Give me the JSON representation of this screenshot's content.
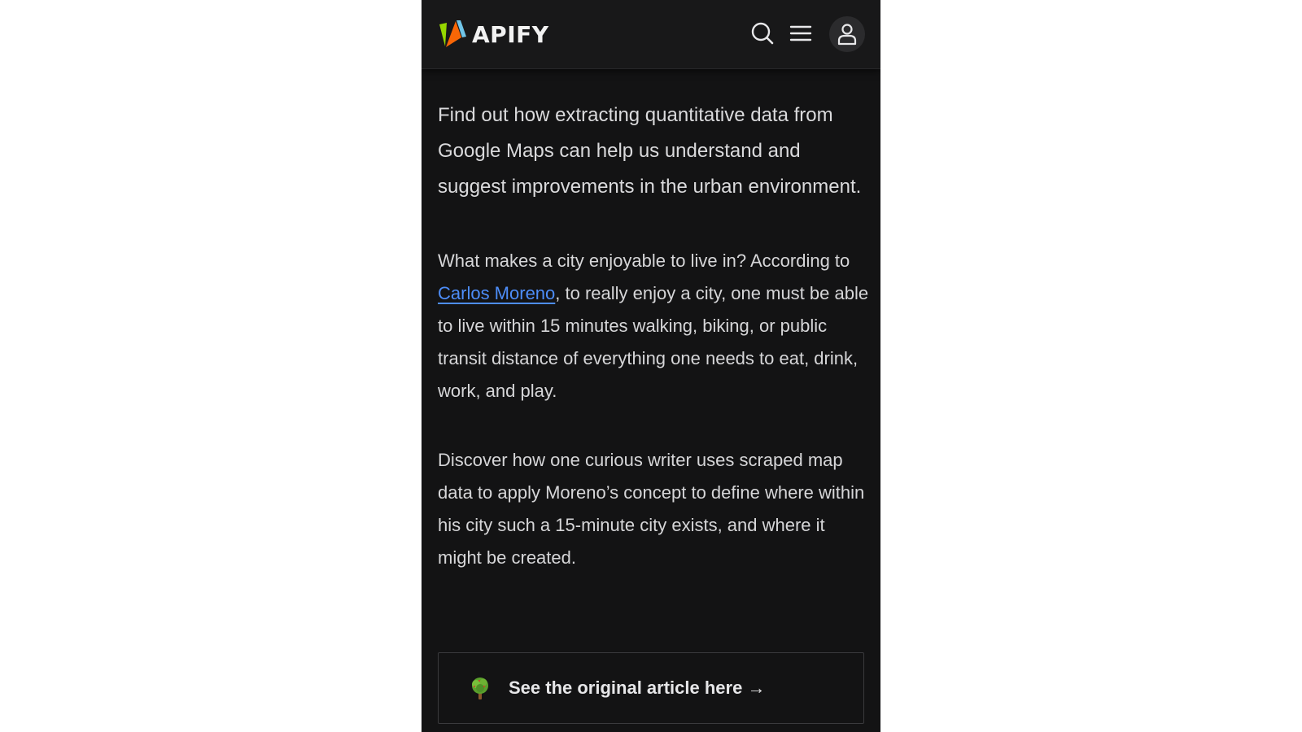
{
  "header": {
    "brand": "APIFY",
    "brand_colors": [
      "#97d700",
      "#f86606",
      "#71c5e8"
    ],
    "icons": {
      "search": "search-icon",
      "menu": "hamburger-menu-icon",
      "account": "user-icon"
    }
  },
  "article": {
    "lead": "Find out how extracting quantitative data from Google Maps can help us understand and suggest improvements in the urban environment.",
    "para1": {
      "before_link": "What makes a city enjoyable to live in? According to ",
      "link_text": "Carlos Moreno",
      "after_link": ", to really enjoy a city, one must be able to live within 15 minutes walking, biking, or public transit distance of everything one needs to eat, drink, work, and play."
    },
    "para2": "Discover how one curious writer uses scraped map data to apply Moreno’s concept to define where within his city such a 15-minute city exists, and where it might be created.",
    "cta": {
      "icon": "tree-emoji-icon",
      "label": "See the original article here →"
    }
  },
  "colors": {
    "background": "#131314",
    "header_background": "#181819",
    "text": "#d6d6d8",
    "link": "#4d8df8",
    "page_margin": "#ffffff"
  }
}
